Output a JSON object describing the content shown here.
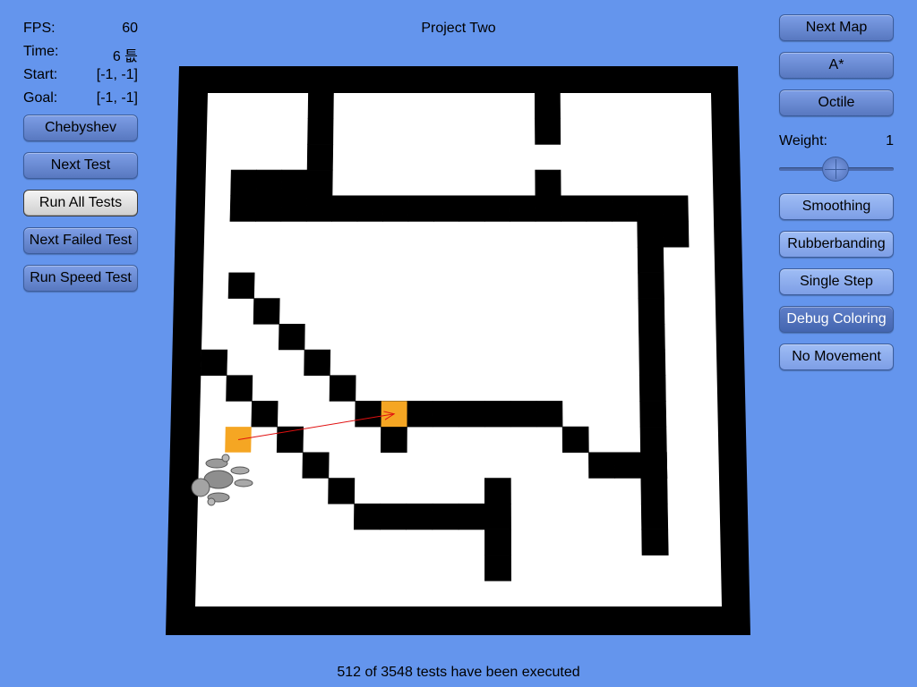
{
  "title": "Project Two",
  "stats": [
    {
      "key": "FPS:",
      "value": "60"
    },
    {
      "key": "Time:",
      "value": "6 틊"
    },
    {
      "key": "Start:",
      "value": "[-1, -1]"
    },
    {
      "key": "Goal:",
      "value": "[-1, -1]"
    }
  ],
  "left_buttons": {
    "heuristic": "Chebyshev",
    "next_test": "Next Test",
    "run_all": "Run All Tests",
    "next_failed": "Next Failed Test",
    "speed_test": "Run Speed Test"
  },
  "right_buttons": {
    "next_map": "Next Map",
    "algorithm": "A*",
    "heuristic": "Octile",
    "smoothing": "Smoothing",
    "rubberbanding": "Rubberbanding",
    "single_step": "Single Step",
    "debug_coloring": "Debug Coloring",
    "no_movement": "No Movement"
  },
  "weight": {
    "label": "Weight:",
    "value": "1"
  },
  "status": "512 of 3548 tests have been executed",
  "colors": {
    "background": "#6495ed",
    "wall": "#000000",
    "floor": "#ffffff",
    "highlight": "#f5a623",
    "path_line": "#e01010"
  },
  "map": {
    "size": 20,
    "walls": [
      [
        1,
        3
      ],
      [
        2,
        3
      ],
      [
        3,
        3
      ],
      [
        4,
        3
      ],
      [
        1,
        4
      ],
      [
        2,
        4
      ],
      [
        3,
        4
      ],
      [
        4,
        4
      ],
      [
        5,
        4
      ],
      [
        6,
        4
      ],
      [
        7,
        4
      ],
      [
        8,
        4
      ],
      [
        9,
        4
      ],
      [
        10,
        4
      ],
      [
        11,
        4
      ],
      [
        12,
        4
      ],
      [
        13,
        4
      ],
      [
        14,
        4
      ],
      [
        15,
        4
      ],
      [
        16,
        4
      ],
      [
        17,
        4
      ],
      [
        18,
        4
      ],
      [
        4,
        0
      ],
      [
        4,
        1
      ],
      [
        4,
        2
      ],
      [
        13,
        0
      ],
      [
        13,
        1
      ],
      [
        13,
        3
      ],
      [
        17,
        5
      ],
      [
        18,
        5
      ],
      [
        17,
        6
      ],
      [
        17,
        7
      ],
      [
        17,
        8
      ],
      [
        17,
        9
      ],
      [
        17,
        10
      ],
      [
        17,
        11
      ],
      [
        17,
        12
      ],
      [
        17,
        13
      ],
      [
        17,
        14
      ],
      [
        17,
        15
      ],
      [
        17,
        16
      ],
      [
        17,
        17
      ],
      [
        1,
        7
      ],
      [
        2,
        8
      ],
      [
        3,
        9
      ],
      [
        4,
        10
      ],
      [
        5,
        11
      ],
      [
        0,
        10
      ],
      [
        1,
        11
      ],
      [
        2,
        12
      ],
      [
        3,
        13
      ],
      [
        6,
        12
      ],
      [
        7,
        12
      ],
      [
        8,
        12
      ],
      [
        9,
        12
      ],
      [
        10,
        12
      ],
      [
        11,
        12
      ],
      [
        12,
        12
      ],
      [
        13,
        12
      ],
      [
        7,
        13
      ],
      [
        14,
        13
      ],
      [
        15,
        14
      ],
      [
        16,
        14
      ],
      [
        17,
        14
      ],
      [
        4,
        14
      ],
      [
        5,
        15
      ],
      [
        6,
        16
      ],
      [
        7,
        16
      ],
      [
        8,
        16
      ],
      [
        9,
        16
      ],
      [
        10,
        16
      ],
      [
        11,
        15
      ],
      [
        11,
        16
      ],
      [
        11,
        17
      ],
      [
        11,
        18
      ]
    ],
    "highlight_cells": [
      [
        7,
        12
      ],
      [
        1,
        13
      ]
    ]
  }
}
